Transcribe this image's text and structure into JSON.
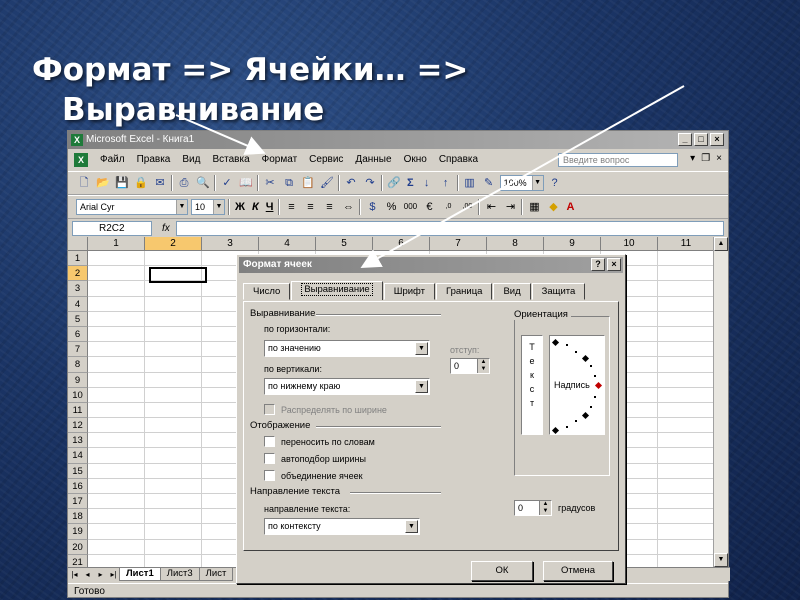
{
  "slide": {
    "title_line1": "Формат => Ячейки… =>",
    "title_line2": "Выравнивание"
  },
  "excel": {
    "window_title": "Microsoft Excel - Книга1",
    "menu": [
      "Файл",
      "Правка",
      "Вид",
      "Вставка",
      "Формат",
      "Сервис",
      "Данные",
      "Окно",
      "Справка"
    ],
    "question_placeholder": "Введите вопрос",
    "font_name": "Arial Cyr",
    "font_size": "10",
    "zoom": "100%",
    "name_box": "R2C2",
    "fx_label": "fx",
    "columns": [
      "1",
      "2",
      "3",
      "4",
      "5",
      "6",
      "7",
      "8",
      "9",
      "10",
      "11"
    ],
    "rows": [
      "1",
      "2",
      "3",
      "4",
      "5",
      "6",
      "7",
      "8",
      "9",
      "10",
      "11",
      "12",
      "13",
      "14",
      "15",
      "16",
      "17",
      "18",
      "19",
      "20",
      "21"
    ],
    "sheet_tabs": [
      "Лист1",
      "Лист3",
      "Лист"
    ],
    "status": "Готово"
  },
  "dialog": {
    "title": "Формат ячеек",
    "tabs": [
      "Число",
      "Выравнивание",
      "Шрифт",
      "Граница",
      "Вид",
      "Защита"
    ],
    "alignment_group": "Выравнивание",
    "horizontal_label": "по горизонтали:",
    "horizontal_value": "по значению",
    "indent_label": "отступ:",
    "indent_value": "0",
    "vertical_label": "по вертикали:",
    "vertical_value": "по нижнему краю",
    "distribute_label": "Распределять по ширине",
    "display_group": "Отображение",
    "wrap_label": "переносить по словам",
    "shrink_label": "автоподбор ширины",
    "merge_label": "объединение ячеек",
    "direction_group": "Направление текста",
    "direction_label": "направление текста:",
    "direction_value": "по контексту",
    "orientation_group": "Ориентация",
    "vertical_text": [
      "Т",
      "е",
      "к",
      "с",
      "т"
    ],
    "dial_text": "Надпись",
    "degrees_value": "0",
    "degrees_label": "градусов",
    "ok": "ОК",
    "cancel": "Отмена"
  }
}
